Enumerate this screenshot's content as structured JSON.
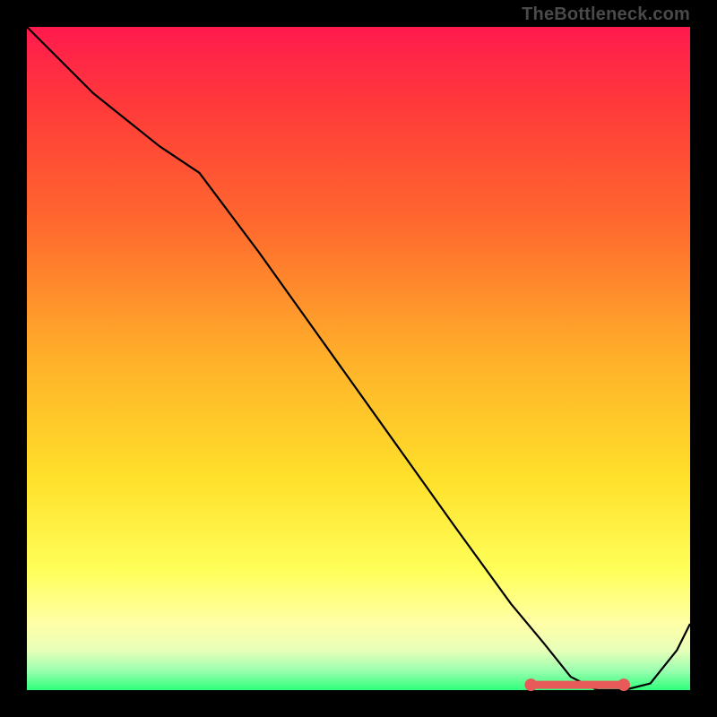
{
  "watermark": "TheBottleneck.com",
  "colors": {
    "gradient_top": "#ff1a4e",
    "gradient_bottom": "#2fff7a",
    "line": "#000000",
    "annotation": "#e85a5a",
    "frame": "#000000"
  },
  "chart_data": {
    "type": "line",
    "title": "",
    "xlabel": "",
    "ylabel": "",
    "xlim": [
      0,
      100
    ],
    "ylim": [
      0,
      100
    ],
    "grid": false,
    "legend": false,
    "series": [
      {
        "name": "bottleneck-curve",
        "x": [
          0,
          5,
          10,
          15,
          20,
          26,
          35,
          45,
          55,
          65,
          73,
          78,
          82,
          86,
          90,
          94,
          98,
          100
        ],
        "values": [
          100,
          95,
          90,
          86,
          82,
          78,
          66,
          52,
          38,
          24,
          13,
          7,
          2,
          0,
          0,
          1,
          6,
          10
        ]
      }
    ],
    "annotation": {
      "name": "optimal-range-marker",
      "x_start": 76,
      "x_end": 90,
      "y": 0.8
    }
  }
}
